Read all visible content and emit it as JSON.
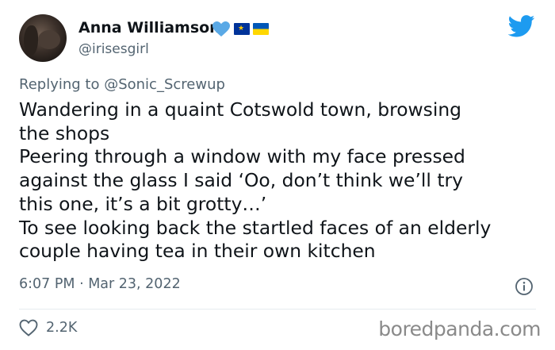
{
  "author": {
    "name": "Anna Williamson",
    "handle": "@irisesgirl",
    "badges": [
      "blue-heart-icon",
      "eu-flag-icon",
      "ukraine-flag-icon"
    ]
  },
  "reply": {
    "text": "Replying to @Sonic_Screwup"
  },
  "tweet": {
    "text": "Wandering in a quaint Cotswold town, browsing\nthe shops\nPeering through a window with my face pressed\nagainst the glass I said ‘Oo, don’t think we’ll try\nthis one, it’s a bit grotty…’\nTo see looking back the startled faces of an elderly\ncouple having tea in their own kitchen"
  },
  "meta": {
    "timestamp": "6:07 PM · Mar 23, 2022"
  },
  "actions": {
    "like_count": "2.2K"
  },
  "watermark": "boredpanda.com",
  "colors": {
    "twitter_blue": "#1d9bf0",
    "heart_blue": "#5aa9e6",
    "secondary_text": "#536471",
    "primary_text": "#0f1419"
  },
  "icons": {
    "logo": "twitter-bird-icon",
    "info": "info-icon",
    "like": "heart-outline-icon"
  }
}
